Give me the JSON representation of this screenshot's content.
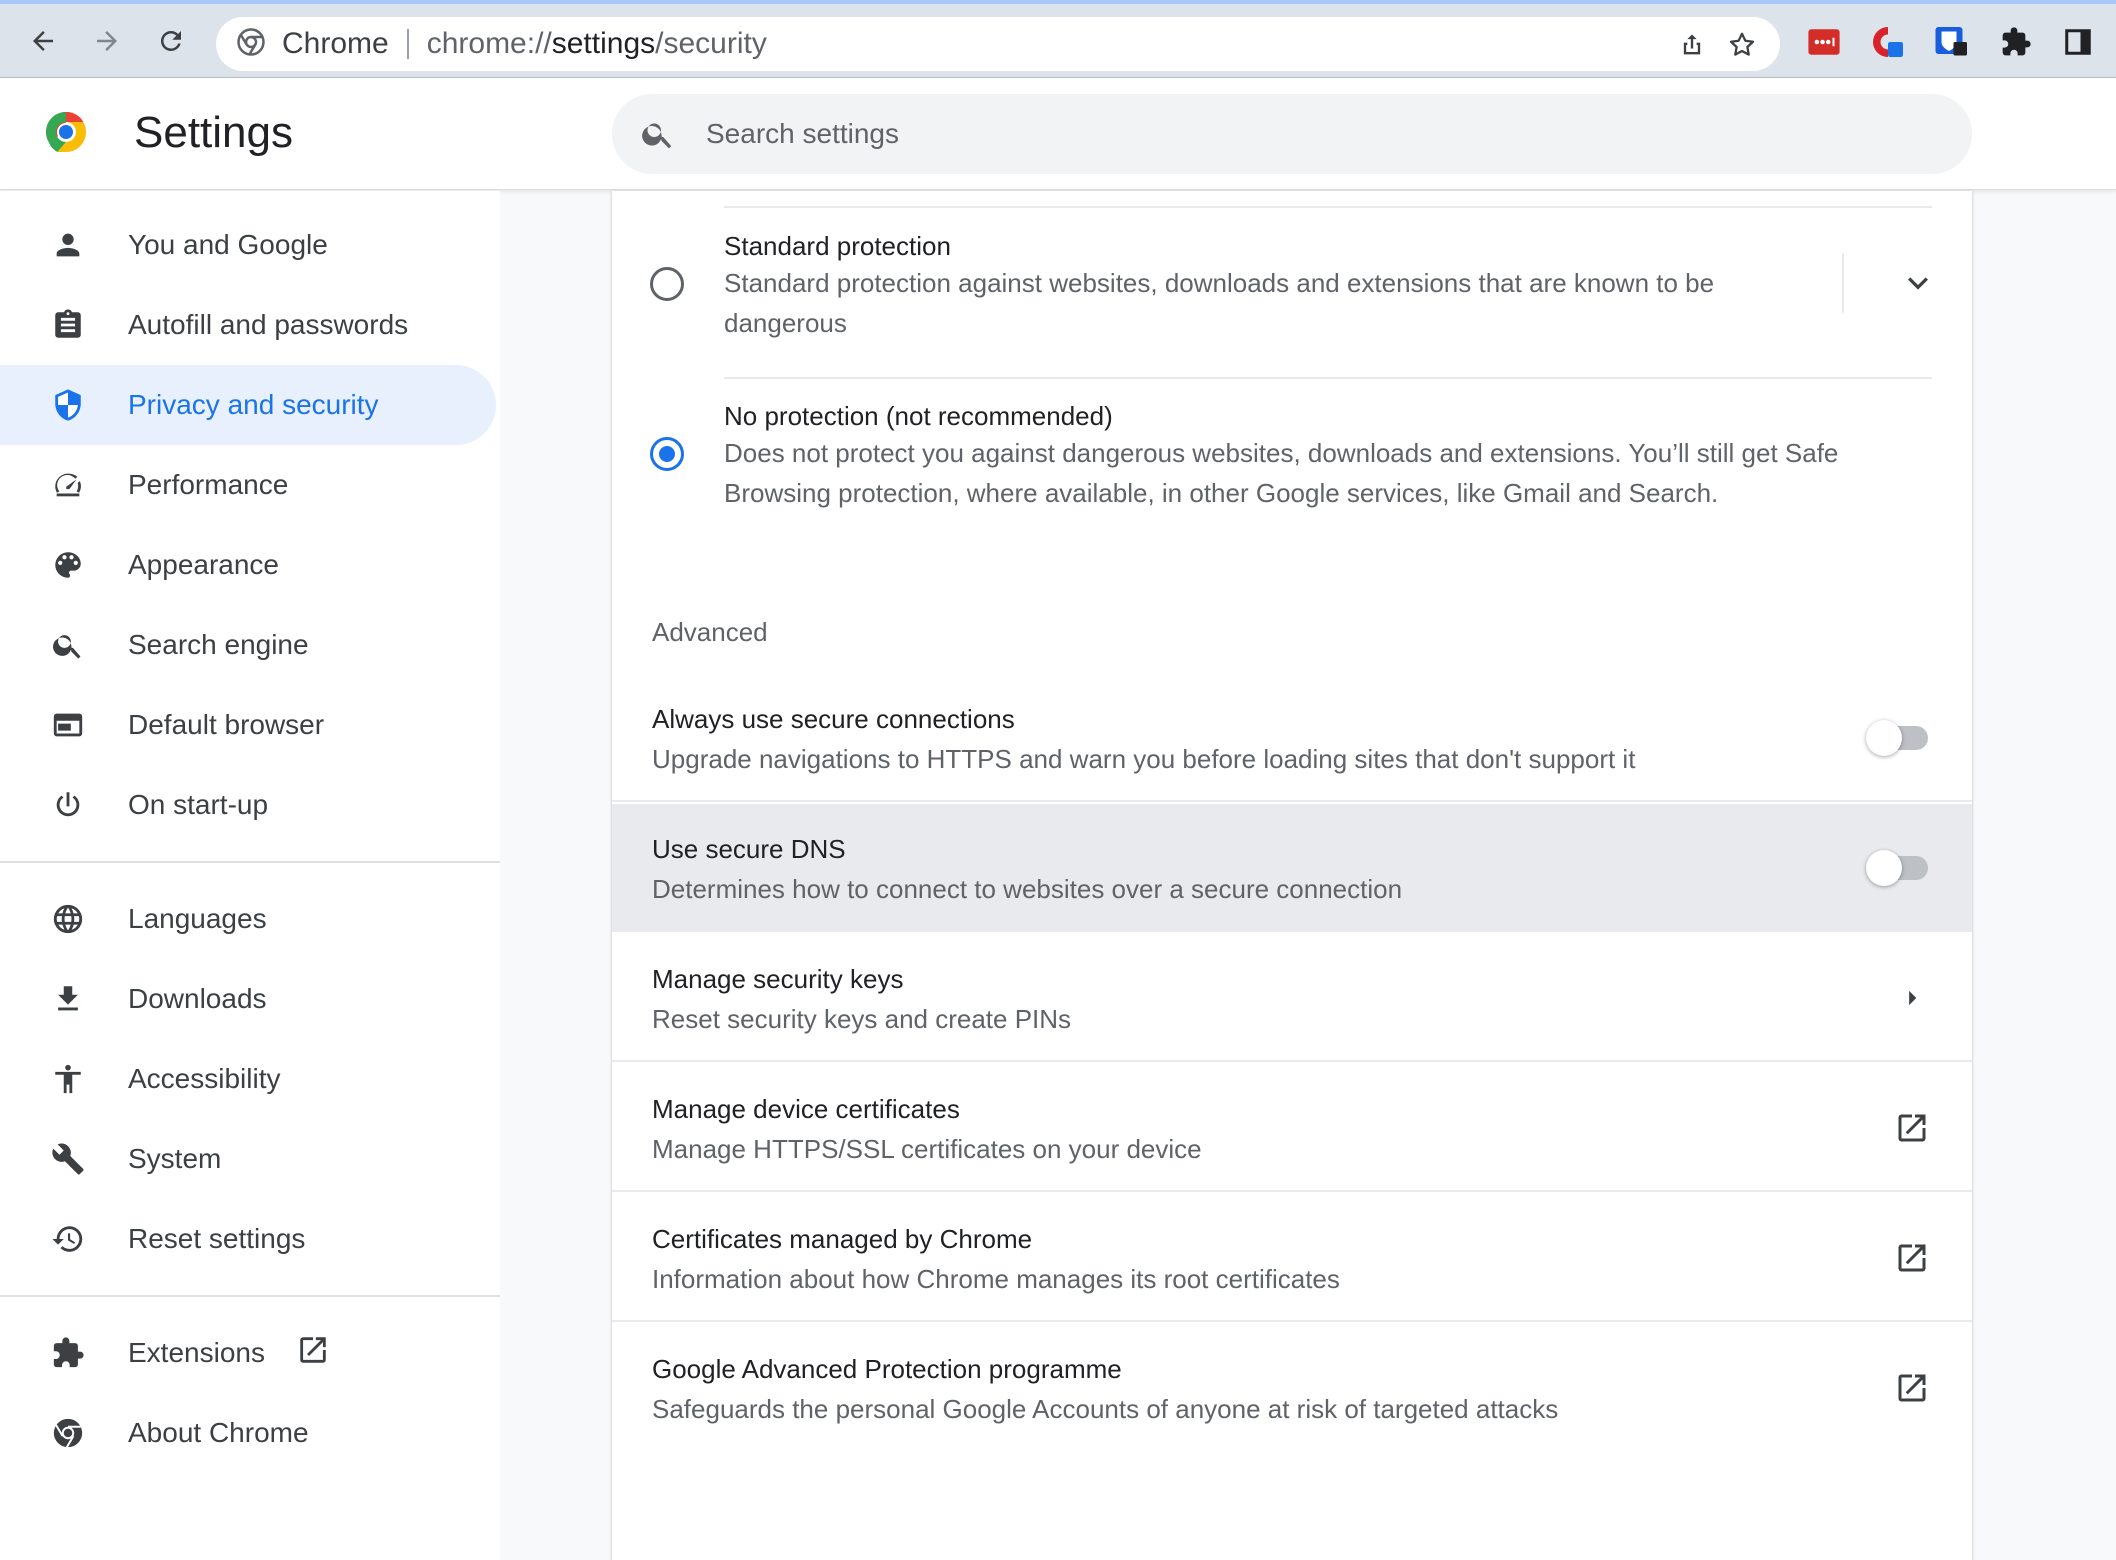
{
  "browser": {
    "site_chip": "Chrome",
    "url_scheme": "chrome://",
    "url_host": "settings",
    "url_path": "/security",
    "icons": [
      "back-icon",
      "forward-icon",
      "reload-icon",
      "share-icon",
      "bookmark-star-icon",
      "lastpass-extension-icon",
      "adblock-extension-icon",
      "bitwarden-extension-icon",
      "extensions-puzzle-icon",
      "side-panel-icon"
    ]
  },
  "header": {
    "title": "Settings",
    "search_placeholder": "Search settings"
  },
  "sidebar": {
    "items": [
      {
        "label": "You and Google",
        "icon": "person-icon"
      },
      {
        "label": "Autofill and passwords",
        "icon": "clipboard-icon"
      },
      {
        "label": "Privacy and security",
        "icon": "shield-icon",
        "active": true
      },
      {
        "label": "Performance",
        "icon": "speedometer-icon"
      },
      {
        "label": "Appearance",
        "icon": "palette-icon"
      },
      {
        "label": "Search engine",
        "icon": "search-icon"
      },
      {
        "label": "Default browser",
        "icon": "browser-window-icon"
      },
      {
        "label": "On start-up",
        "icon": "power-icon"
      },
      {
        "label": "Languages",
        "icon": "globe-icon"
      },
      {
        "label": "Downloads",
        "icon": "download-icon"
      },
      {
        "label": "Accessibility",
        "icon": "accessibility-icon"
      },
      {
        "label": "System",
        "icon": "wrench-icon"
      },
      {
        "label": "Reset settings",
        "icon": "history-icon"
      },
      {
        "label": "Extensions",
        "icon": "puzzle-icon"
      },
      {
        "label": "About Chrome",
        "icon": "chrome-icon"
      }
    ]
  },
  "main": {
    "protection_options": [
      {
        "title": "Standard protection",
        "description": "Standard protection against websites, downloads and extensions that are known to be dangerous",
        "checked": false
      },
      {
        "title": "No protection (not recommended)",
        "description": "Does not protect you against dangerous websites, downloads and extensions. You’ll still get Safe Browsing protection, where available, in other Google services, like Gmail and Search.",
        "checked": true
      }
    ],
    "advanced_heading": "Advanced",
    "advanced_rows": [
      {
        "title": "Always use secure connections",
        "description": "Upgrade navigations to HTTPS and warn you before loading sites that don't support it",
        "control": "toggle",
        "on": false
      },
      {
        "title": "Use secure DNS",
        "description": "Determines how to connect to websites over a secure connection",
        "control": "toggle",
        "on": false
      },
      {
        "title": "Manage security keys",
        "description": "Reset security keys and create PINs",
        "control": "arrow"
      },
      {
        "title": "Manage device certificates",
        "description": "Manage HTTPS/SSL certificates on your device",
        "control": "external-link"
      },
      {
        "title": "Certificates managed by Chrome",
        "description": "Information about how Chrome manages its root certificates",
        "control": "external-link"
      },
      {
        "title": "Google Advanced Protection programme",
        "description": "Safeguards the personal Google Accounts of anyone at risk of targeted attacks",
        "control": "external-link"
      }
    ]
  },
  "colors": {
    "accent": "#1a73e8",
    "active_bg": "#e8f0fe",
    "toolbar_bg": "#dde3ea"
  }
}
